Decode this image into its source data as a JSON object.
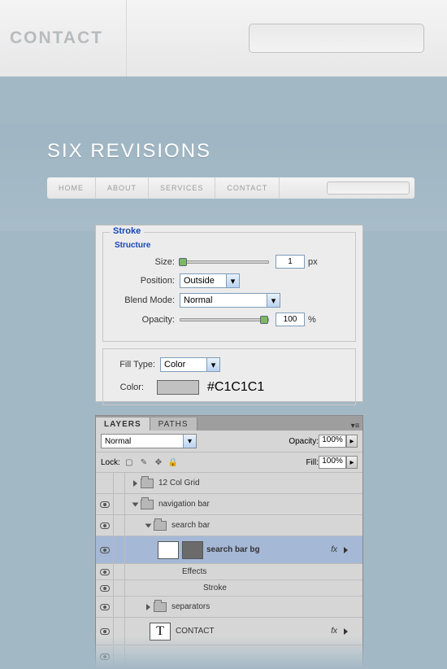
{
  "topbar": {
    "contact": "CONTACT"
  },
  "preview": {
    "title": "SIX REVISIONS",
    "nav": [
      "HOME",
      "ABOUT",
      "SERVICES",
      "CONTACT"
    ]
  },
  "stroke": {
    "title": "Stroke",
    "structure": "Structure",
    "size_label": "Size:",
    "size_value": "1",
    "size_unit": "px",
    "position_label": "Position:",
    "position_value": "Outside",
    "blend_label": "Blend Mode:",
    "blend_value": "Normal",
    "opacity_label": "Opacity:",
    "opacity_value": "100",
    "opacity_unit": "%",
    "filltype_label": "Fill Type:",
    "filltype_value": "Color",
    "color_label": "Color:",
    "color_hex": "#C1C1C1"
  },
  "layers": {
    "tabs": [
      "LAYERS",
      "PATHS"
    ],
    "blend_mode": "Normal",
    "opacity_label": "Opacity:",
    "opacity_value": "100%",
    "lock_label": "Lock:",
    "fill_label": "Fill:",
    "fill_value": "100%",
    "items": {
      "grid": "12 Col Grid",
      "navbar": "navigation bar",
      "searchbar": "search bar",
      "searchbg": "search bar bg",
      "effects": "Effects",
      "stroke": "Stroke",
      "separators": "separators",
      "contact": "CONTACT"
    },
    "fx": "fx"
  }
}
